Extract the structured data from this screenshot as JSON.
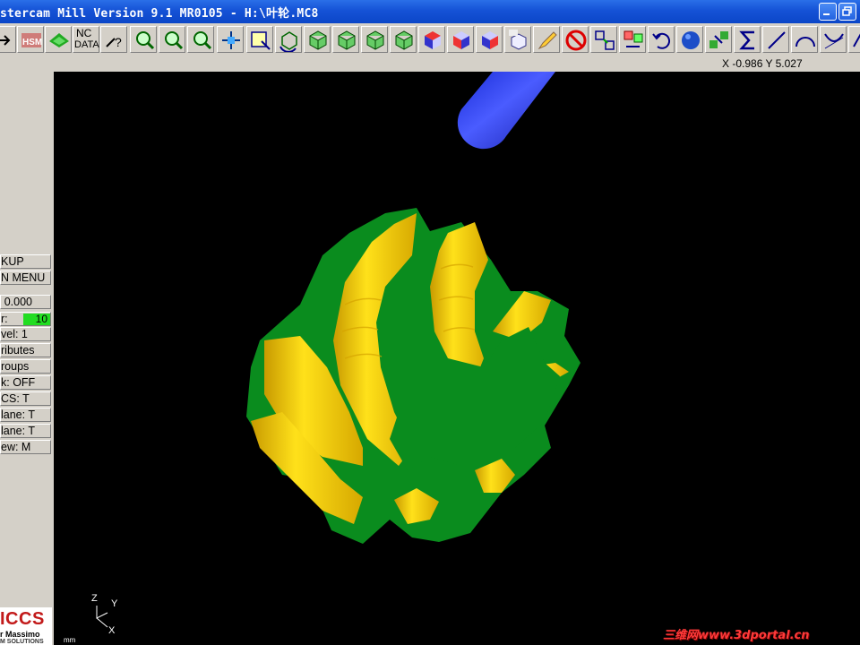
{
  "window": {
    "title": "stercam Mill Version 9.1 MR0105 - H:\\叶轮.MC8"
  },
  "toolbar": {
    "nc_label_top": "NC",
    "nc_label_bottom": "DATA",
    "icons": [
      "back-arrow-icon",
      "hsm-icon",
      "mold-icon",
      "nc-data-icon",
      "help-pointer-icon",
      "zoom-window-icon",
      "zoom-in-icon",
      "zoom-out-icon",
      "pan-icon",
      "select-window-icon",
      "rotate-view-icon",
      "view-top-cube-icon",
      "view-front-cube-icon",
      "view-side-cube-icon",
      "view-iso-cube-icon",
      "shaded-cube-icon",
      "shaded-cube-2-icon",
      "shaded-cube-3-icon",
      "3d-cube-icon",
      "pencil-icon",
      "no-entry-icon",
      "transform-icon",
      "transform-2-icon",
      "undo-icon",
      "sphere-icon",
      "layers-icon",
      "sigma-icon",
      "line-icon",
      "arc-icon",
      "curve-icon",
      "more-icon"
    ]
  },
  "status": {
    "coordinates": "X -0.986  Y 5.027"
  },
  "left_menu": [
    {
      "label": "KUP"
    },
    {
      "label": "N MENU"
    },
    {
      "label": "0.000"
    },
    {
      "label": "r:",
      "value": "10"
    },
    {
      "label": "vel:  1"
    },
    {
      "label": "ributes"
    },
    {
      "label": "roups"
    },
    {
      "label": "k:  OFF"
    },
    {
      "label": "CS:   T"
    },
    {
      "label": "lane:  T"
    },
    {
      "label": "lane:  T"
    },
    {
      "label": "ew:   M"
    }
  ],
  "logo": {
    "main": "ICCS",
    "sub": "r Massimo",
    "sub2": "M SOLUTIONS"
  },
  "viewport": {
    "axis_z": "Z",
    "axis_y": "Y",
    "axis_x": "X",
    "units": "mm",
    "colors": {
      "background": "#000000",
      "part_green": "#0a8c1e",
      "part_yellow": "#f0c800",
      "tool_blue": "#2233dd"
    }
  },
  "watermark": "三维网www.3dportal.cn"
}
